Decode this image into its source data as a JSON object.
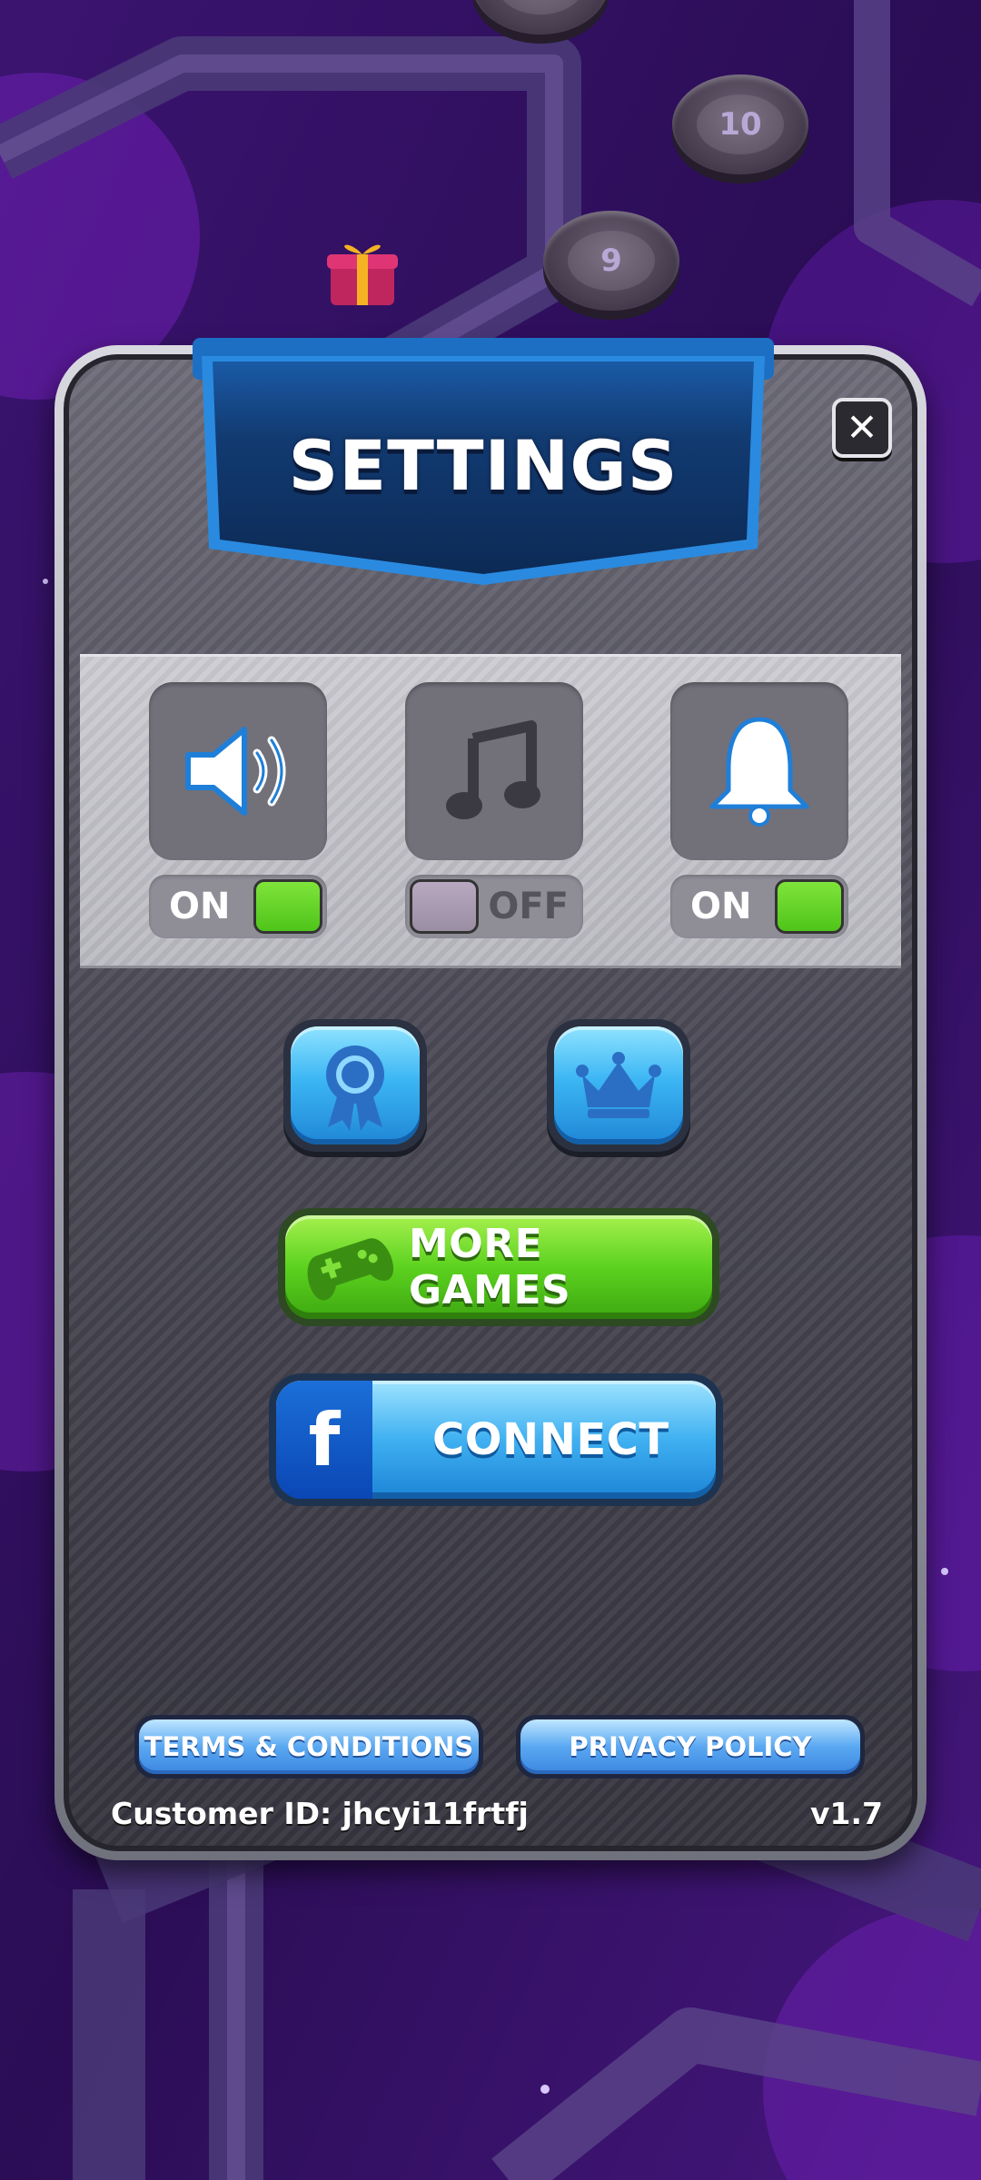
{
  "map": {
    "level_nodes": [
      "10",
      "9"
    ]
  },
  "settings": {
    "title": "SETTINGS",
    "toggles": [
      {
        "name": "sound",
        "icon": "speaker-icon",
        "state_label": "ON",
        "on": true
      },
      {
        "name": "music",
        "icon": "music-note-icon",
        "state_label": "OFF",
        "on": false
      },
      {
        "name": "notifications",
        "icon": "bell-icon",
        "state_label": "ON",
        "on": true
      }
    ],
    "round_buttons": [
      {
        "icon": "award-ribbon-icon"
      },
      {
        "icon": "crown-icon"
      }
    ],
    "more_games_label": "MORE GAMES",
    "fb_letter": "f",
    "connect_label": "CONNECT",
    "terms_label": "TERMS & CONDITIONS",
    "privacy_label": "PRIVACY POLICY",
    "customer_id": "Customer ID: jhcyi11frtfj",
    "version": "v1.7"
  },
  "colors": {
    "accent_green": "#5cd21f",
    "accent_blue": "#3cb6f4",
    "ribbon_blue": "#123b72",
    "background_purple": "#2a0f52"
  }
}
